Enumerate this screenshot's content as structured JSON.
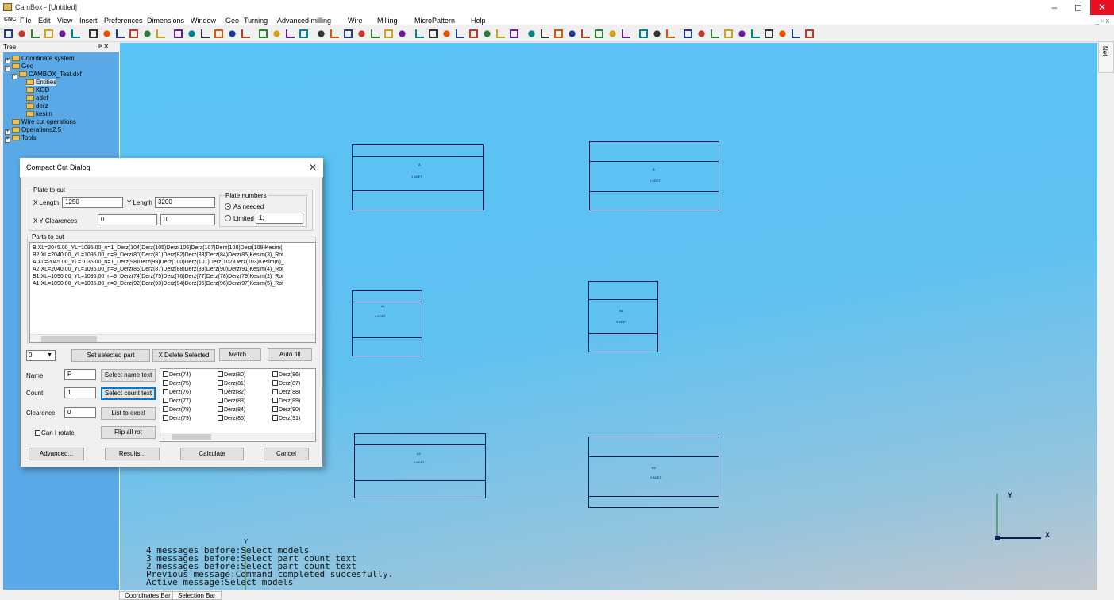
{
  "window": {
    "title": "CamBox - [Untitled]",
    "min": "–",
    "max": "◻",
    "close": "✕"
  },
  "menu": {
    "logo": "CNC",
    "items": [
      "File",
      "Edit",
      "View",
      "Insert",
      "Preferences",
      "Dimensions",
      "Window",
      "Geo",
      "Turning",
      "Advanced milling",
      "Wire",
      "Milling",
      "MicroPattern",
      "Help"
    ],
    "mdi": "_ ▫ x"
  },
  "toolbar": {
    "icons": [
      "new-icon",
      "open-icon",
      "save-icon",
      "delete-icon",
      "help-icon",
      "arrows-icon",
      "zoom-window-icon",
      "zoom-fit-icon",
      "zoom-icon",
      "cut-icon",
      "view-front-icon",
      "view-side-icon",
      "view-top-icon",
      "view-iso-icon",
      "close-view-icon",
      "layers-icon",
      "layers2-icon",
      "mirror-icon",
      "green-dot-icon",
      "color-wheel-icon",
      "select-icon",
      "list-icon",
      "dim-icon",
      "text-icon",
      "measure-icon",
      "dim-line-icon",
      "snap-icon",
      "magic-icon",
      "points-icon",
      "line-icon",
      "circle-icon",
      "polyline-icon",
      "fillet-icon",
      "trim-icon",
      "extend-icon",
      "arc-icon",
      "contour-icon",
      "chain-icon",
      "round-icon",
      "offset-icon",
      "chamfer-icon",
      "angle-icon",
      "spiral-icon",
      "ellipse-icon",
      "target-icon",
      "dot-red-icon",
      "bar1-icon",
      "bar2-icon",
      "bar3-icon",
      "grid1-icon",
      "grid2-icon",
      "tool1-icon",
      "tool2-icon",
      "tool3-icon",
      "tool4-icon",
      "arrow-icon",
      "menu-icon",
      "table-icon"
    ]
  },
  "tree": {
    "title": "Tree",
    "pin": "ᴘ ✕",
    "nodes": [
      {
        "label": "Coordinate system",
        "pm": "+"
      },
      {
        "label": "Geo",
        "pm": "-"
      },
      {
        "label": "CAMBOX_Test.dxf",
        "pm": "-"
      },
      {
        "label": "Entities",
        "pm": ""
      },
      {
        "label": "KOD",
        "pm": ""
      },
      {
        "label": "adet",
        "pm": ""
      },
      {
        "label": "derz",
        "pm": ""
      },
      {
        "label": "kesim",
        "pm": ""
      },
      {
        "label": "Wire cut operations",
        "pm": ""
      },
      {
        "label": "Operations2.5",
        "pm": "+"
      },
      {
        "label": "Tools",
        "pm": "+"
      }
    ]
  },
  "net_tab": "Net",
  "parts": [
    {
      "name": "A",
      "qty": "1 ADET"
    },
    {
      "name": "B",
      "qty": "1 ADET"
    },
    {
      "name": "A1",
      "qty": "9 ADET"
    },
    {
      "name": "B1",
      "qty": "9 ADET"
    },
    {
      "name": "A2",
      "qty": "9 ADET"
    },
    {
      "name": "B2",
      "qty": "9 ADET"
    }
  ],
  "axes": {
    "y": "Y",
    "x": "X",
    "small_y": "Y"
  },
  "messages": [
    "4 messages before:Select models",
    "3 messages before:Select part count text",
    "2 messages before:Select part count text",
    "Previous message:Command completed succesfully.",
    "Active message:Select models"
  ],
  "statusbar": {
    "tabs": [
      "Coordinates Bar",
      "Selection Bar"
    ]
  },
  "dialog": {
    "title": "Compact Cut Dialog",
    "close": "✕",
    "plate": {
      "group": "Plate to cut",
      "x_label": "X Length",
      "x_value": "1250",
      "y_label": "Y Length",
      "y_value": "3200",
      "clear_label": "X Y Clearences",
      "clear_x": "0",
      "clear_y": "0"
    },
    "plate_numbers": {
      "group": "Plate numbers",
      "as_needed": "As needed",
      "limited": "Limited",
      "limited_value": "1;"
    },
    "parts_group": "Parts to cut",
    "parts_list": [
      "B:XL=2045.00_YL=1095.00_n=1_Derz(104)Derz(105)Derz(106)Derz(107)Derz(108)Derz(109)Kesim(",
      "B2:XL=2040.00_YL=1095.00_n=9_Derz(80)Derz(81)Derz(82)Derz(83)Derz(84)Derz(85)Kesim(3)_Rot",
      "A:XL=2045.00_YL=1035.00_n=1_Derz(98)Derz(99)Derz(100)Derz(101)Derz(102)Derz(103)Kesim(6)_",
      "A2:XL=2040.00_YL=1035.00_n=9_Derz(86)Derz(87)Derz(88)Derz(89)Derz(90)Derz(91)Kesim(4)_Rot",
      "B1:XL=1090.00_YL=1095.00_n=9_Derz(74)Derz(75)Derz(76)Derz(77)Derz(78)Derz(79)Kesim(2)_Rot",
      "A1:XL=1090.00_YL=1035.00_n=9_Derz(92)Derz(93)Derz(94)Derz(95)Derz(96)Derz(97)Kesim(5)_Rot"
    ],
    "combo_value": "0",
    "set_selected": "Set selected part",
    "delete_selected": "X  Delete Selected",
    "match": "Match...",
    "auto_fill": "Auto fill",
    "name_label": "Name",
    "name_value": "P",
    "select_name": "Select name text",
    "count_label": "Count",
    "count_value": "1",
    "select_count": "Select count text",
    "clearence_label": "Clearence",
    "clearence_value": "0",
    "list_excel": "List to excel",
    "can_rotate": "Can I rotate",
    "flip_all": "Flip all rot",
    "derz": [
      [
        "Derz(74)",
        "Derz(80)",
        "Derz(86)"
      ],
      [
        "Derz(75)",
        "Derz(81)",
        "Derz(87)"
      ],
      [
        "Derz(76)",
        "Derz(82)",
        "Derz(88)"
      ],
      [
        "Derz(77)",
        "Derz(83)",
        "Derz(89)"
      ],
      [
        "Derz(78)",
        "Derz(84)",
        "Derz(90)"
      ],
      [
        "Derz(79)",
        "Derz(85)",
        "Derz(91)"
      ]
    ],
    "advanced": "Advanced...",
    "results": "Results...",
    "calculate": "Calculate",
    "cancel": "Cancel"
  }
}
